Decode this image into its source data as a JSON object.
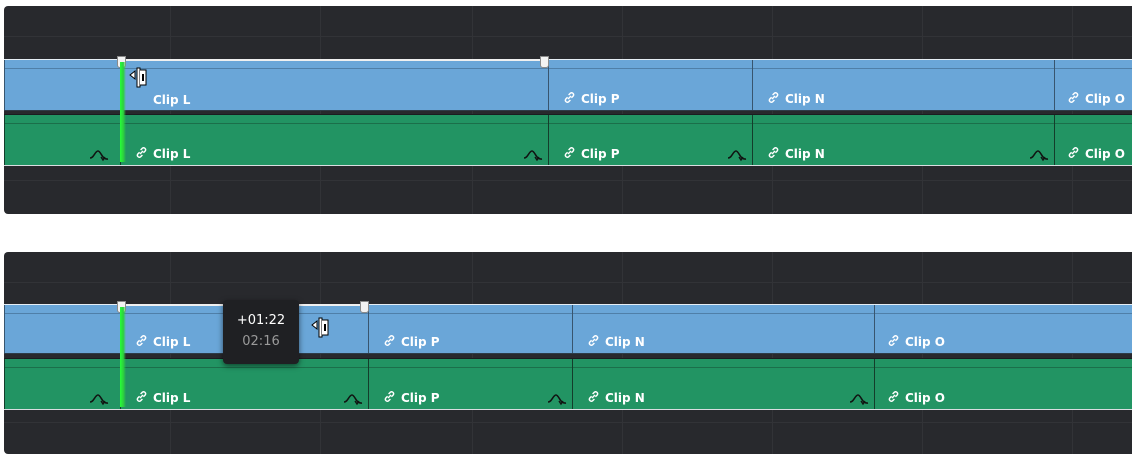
{
  "top_panel": {
    "video_clips": [
      {
        "name": "Clip L",
        "selected": true,
        "link_icon_hidden": true
      },
      {
        "name": "Clip P"
      },
      {
        "name": "Clip N"
      },
      {
        "name": "Clip O"
      }
    ],
    "audio_clips": [
      {
        "name": "Clip L"
      },
      {
        "name": "Clip P"
      },
      {
        "name": "Clip N"
      },
      {
        "name": "Clip O"
      }
    ]
  },
  "bottom_panel": {
    "video_clips": [
      {
        "name": "Clip L",
        "selected": true
      },
      {
        "name": "Clip P"
      },
      {
        "name": "Clip N"
      },
      {
        "name": "Clip O"
      }
    ],
    "audio_clips": [
      {
        "name": "Clip L"
      },
      {
        "name": "Clip P"
      },
      {
        "name": "Clip N"
      },
      {
        "name": "Clip O"
      }
    ],
    "trim_tooltip": {
      "delta": "+01:22",
      "duration": "02:16"
    }
  },
  "icons": {
    "link": "link-icon",
    "fade": "audio-fade-curve-icon",
    "trim_cursor": "ripple-trim-cursor-icon"
  },
  "colors": {
    "video_track": "#6aa6d8",
    "audio_track": "#229463",
    "edit_point": "#26ff38",
    "timeline_bg": "#28292d"
  }
}
